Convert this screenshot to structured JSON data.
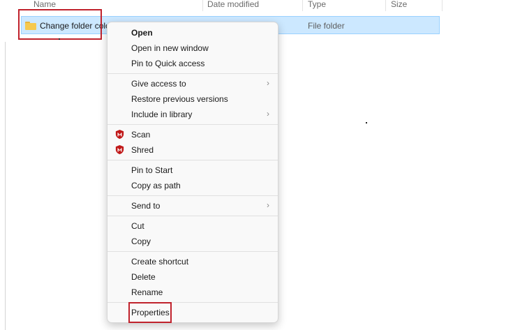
{
  "columns": {
    "name": "Name",
    "date_modified": "Date modified",
    "type": "Type",
    "size": "Size"
  },
  "file": {
    "name": "Change folder colo",
    "type": "File folder"
  },
  "context_menu": {
    "open": "Open",
    "open_new_window": "Open in new window",
    "pin_quick_access": "Pin to Quick access",
    "give_access": "Give access to",
    "restore_versions": "Restore previous versions",
    "include_library": "Include in library",
    "scan": "Scan",
    "shred": "Shred",
    "pin_start": "Pin to Start",
    "copy_path": "Copy as path",
    "send_to": "Send to",
    "cut": "Cut",
    "copy": "Copy",
    "create_shortcut": "Create shortcut",
    "delete": "Delete",
    "rename": "Rename",
    "properties": "Properties"
  },
  "colors": {
    "selection": "#cce8ff",
    "highlight": "#c0222c",
    "mcafee": "#c01818"
  },
  "icons": {
    "folder": "folder-icon",
    "submenu": "chevron-right-icon",
    "scan": "mcafee-shield-icon"
  }
}
